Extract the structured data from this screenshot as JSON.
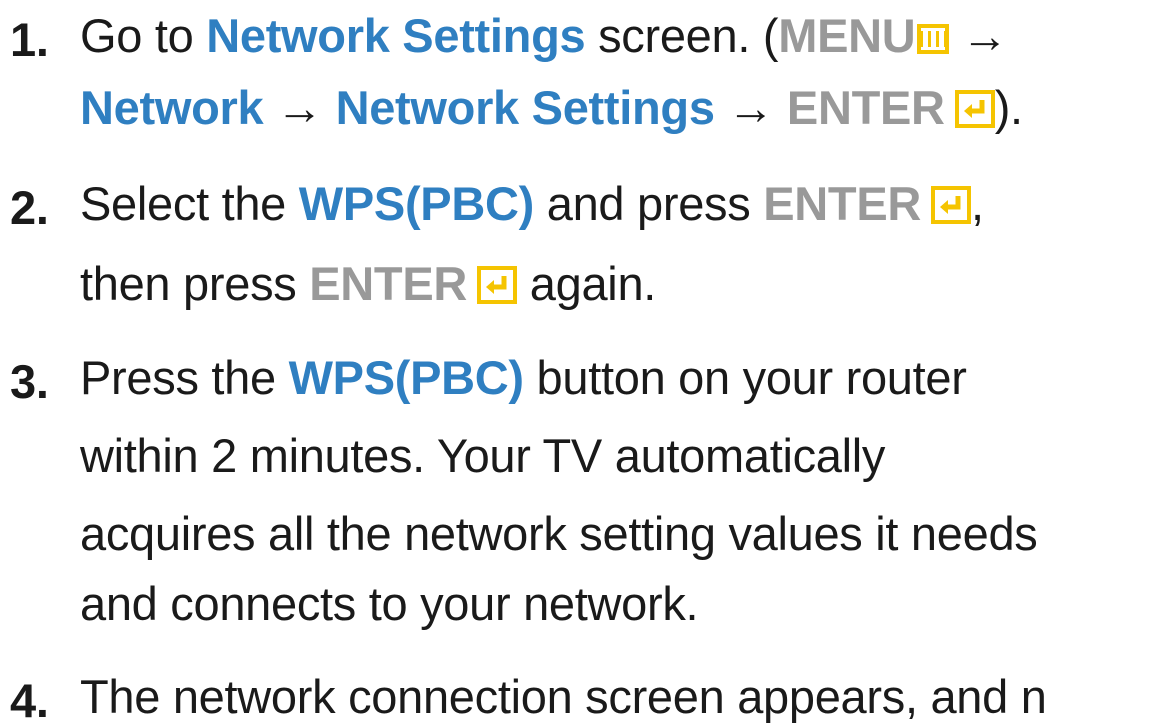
{
  "steps": [
    {
      "number": "1.",
      "lines": [
        [
          "Go to ",
          "Network Settings",
          " screen. (",
          "MENU",
          "→"
        ],
        [
          "Network",
          " → ",
          "Network Settings",
          " → ",
          "ENTER",
          ")."
        ]
      ]
    },
    {
      "number": "2.",
      "lines": [
        [
          "Select the ",
          "WPS(PBC)",
          " and press ",
          "ENTER",
          ","
        ],
        [
          "then press ",
          "ENTER",
          " again."
        ]
      ]
    },
    {
      "number": "3.",
      "lines": [
        [
          "Press the ",
          "WPS(PBC)",
          " button on your router"
        ],
        [
          "within 2 minutes. Your TV automatically"
        ],
        [
          "acquires all the network setting values it needs"
        ],
        [
          "and connects to your network."
        ]
      ]
    },
    {
      "number": "4.",
      "lines": [
        [
          "The network connection screen appears, and n"
        ]
      ]
    }
  ],
  "icons": {
    "menu": "menu-button-icon",
    "enter": "enter-return-icon"
  },
  "colors": {
    "highlight_blue": "#2f7fc1",
    "button_gray": "#999999",
    "icon_yellow": "#f5c400"
  }
}
